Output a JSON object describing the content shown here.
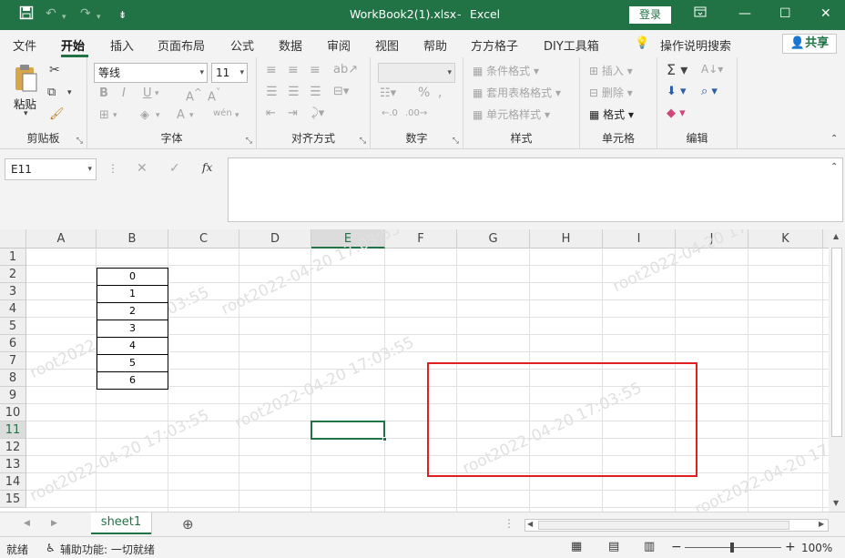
{
  "title_bar": {
    "filename": "WorkBook2(1).xlsx",
    "separator": "-",
    "app": "Excel",
    "login": "登录",
    "icons": [
      "save-icon",
      "undo-icon",
      "redo-icon",
      "customize-icon",
      "ribbon-display-icon",
      "minimize-icon",
      "maximize-icon",
      "close-icon"
    ],
    "accent": "#217346"
  },
  "menu": {
    "tabs": [
      "文件",
      "开始",
      "插入",
      "页面布局",
      "公式",
      "数据",
      "审阅",
      "视图",
      "帮助",
      "方方格子",
      "DIY工具箱"
    ],
    "active": "开始",
    "tell_me": "操作说明搜索",
    "share": "共享"
  },
  "ribbon": {
    "clipboard": {
      "label": "剪贴板",
      "paste": "粘贴"
    },
    "font": {
      "label": "字体",
      "font_name": "等线",
      "font_size": "11",
      "bold": "B",
      "italic": "I",
      "underline": "U",
      "wen": "wén"
    },
    "alignment": {
      "label": "对齐方式"
    },
    "number": {
      "label": "数字",
      "percent": "%"
    },
    "styles": {
      "label": "样式",
      "conditional": "条件格式",
      "table": "套用表格格式",
      "cell": "单元格样式"
    },
    "cells": {
      "label": "单元格",
      "insert": "插入",
      "delete": "删除",
      "format": "格式"
    },
    "editing": {
      "label": "编辑"
    }
  },
  "formula_bar": {
    "name_box": "E11",
    "formula": "",
    "fx": "fx"
  },
  "sheet": {
    "columns": [
      "A",
      "B",
      "C",
      "D",
      "E",
      "F",
      "G",
      "H",
      "I",
      "J",
      "K"
    ],
    "rows": [
      "1",
      "2",
      "3",
      "4",
      "5",
      "6",
      "7",
      "8",
      "9",
      "10",
      "11",
      "12",
      "13",
      "14",
      "15"
    ],
    "selected_column": "E",
    "selected_row": "11",
    "b_values": [
      "0",
      "1",
      "2",
      "3",
      "4",
      "5",
      "6"
    ],
    "watermark": "root2022-04-20 17:03:55",
    "red_box_color": "#e02020"
  },
  "sheet_tabs": {
    "active": "sheet1",
    "add": "+"
  },
  "status_bar": {
    "ready": "就绪",
    "accessibility": "辅助功能: 一切就绪",
    "zoom": "100%",
    "minus": "−",
    "plus": "+"
  }
}
